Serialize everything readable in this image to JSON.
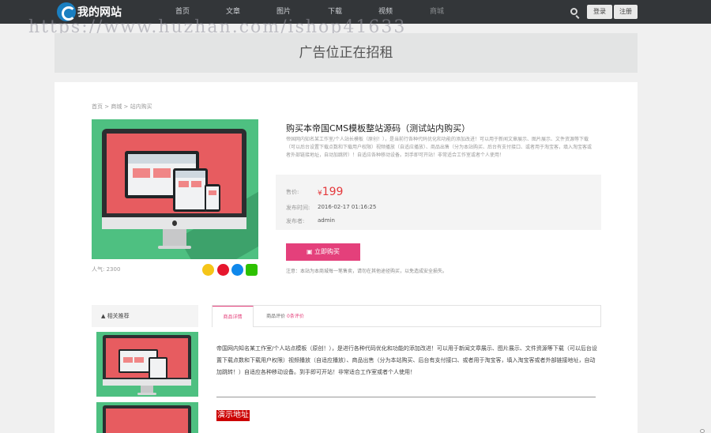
{
  "header": {
    "logo_text": "我的网站",
    "nav": [
      "首页",
      "文章",
      "图片",
      "下载",
      "视频",
      "商城"
    ],
    "login_label": "登录",
    "register_label": "注册"
  },
  "watermark": "https://www.huzhan.com/ishop41633",
  "ad_text": "广告位正在招租",
  "breadcrumb": "首页 > 商城 > 站内购买",
  "product": {
    "title": "购买本帝国CMS模板整站源码（测试站内购买）",
    "description": "帝国网内知名某工作室/个人站长模板（原创！），是当前行各种代码优化和功能的添加改进！可以用于新闻文章展示、图片展示、文件资源等下载（可以后台设置下载点数和下载用户权限）视频播放（自适应播放）、商品出售（分为本站购买、后台有支付接口、或者用于淘宝客，填入淘宝客或者外部链接地址，自动加跳转）！自适应各种移动设备。到手即可开站！非常适合工作室或者个人使用！",
    "price_label": "售价:",
    "currency": "¥",
    "price": "199",
    "date_label": "发布时间:",
    "date": "2016-02-17 01:16:25",
    "publisher_label": "发布者:",
    "publisher": "admin",
    "views": "人气: 2300",
    "buy_label": "立即购买",
    "notice": "注意：本站为本商城每一笔售卖，请勿在其他途径购买，以免造成安全损失。"
  },
  "related": {
    "title": "相关推荐"
  },
  "tabs": {
    "details": "商品详情",
    "reviews": "商品评价",
    "reviews_count": "0条评价"
  },
  "content": {
    "body": "帝国网内知名某工作室/个人站点模板（原创！），是进行各种代码优化和功能的添加改进！可以用于新闻文章展示、图片展示、文件资源等下载（可以后台设置下载点数和下载用户权限）视频播放（自适应播放）、商品出售（分为本站购买、后台有支付接口、或者用于淘宝客，填入淘宝客或者外部链接地址，自动加跳转！）自适应各种移动设备。到手即可开站！非常适合工作室或者个人使用！",
    "demo_label": "演示地址"
  },
  "colors": {
    "topbar": "#333639",
    "accent": "#e4407b",
    "price": "#e4393c",
    "product_bg": "#4ec081",
    "screen": "#e75c60"
  }
}
